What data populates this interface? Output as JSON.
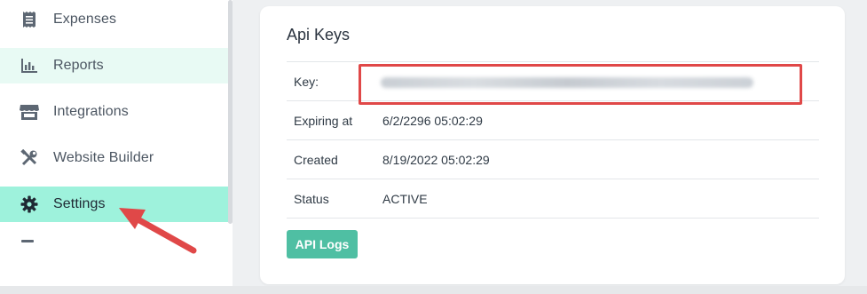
{
  "sidebar": {
    "items": [
      {
        "label": "Expenses",
        "icon": "receipt-icon"
      },
      {
        "label": "Reports",
        "icon": "bar-chart-icon"
      },
      {
        "label": "Integrations",
        "icon": "store-icon"
      },
      {
        "label": "Website Builder",
        "icon": "tools-icon"
      },
      {
        "label": "Settings",
        "icon": "gear-icon"
      }
    ]
  },
  "card": {
    "title": "Api Keys",
    "rows": [
      {
        "label": "Key:",
        "value": ""
      },
      {
        "label": "Expiring at",
        "value": "6/2/2296 05:02:29"
      },
      {
        "label": "Created",
        "value": "8/19/2022 05:02:29"
      },
      {
        "label": "Status",
        "value": "ACTIVE"
      }
    ],
    "button_label": "API Logs"
  },
  "colors": {
    "active_nav": "#9ef2dc",
    "hover_nav": "#e8faf4",
    "button": "#4fbfa3",
    "annotation": "#e04848"
  }
}
